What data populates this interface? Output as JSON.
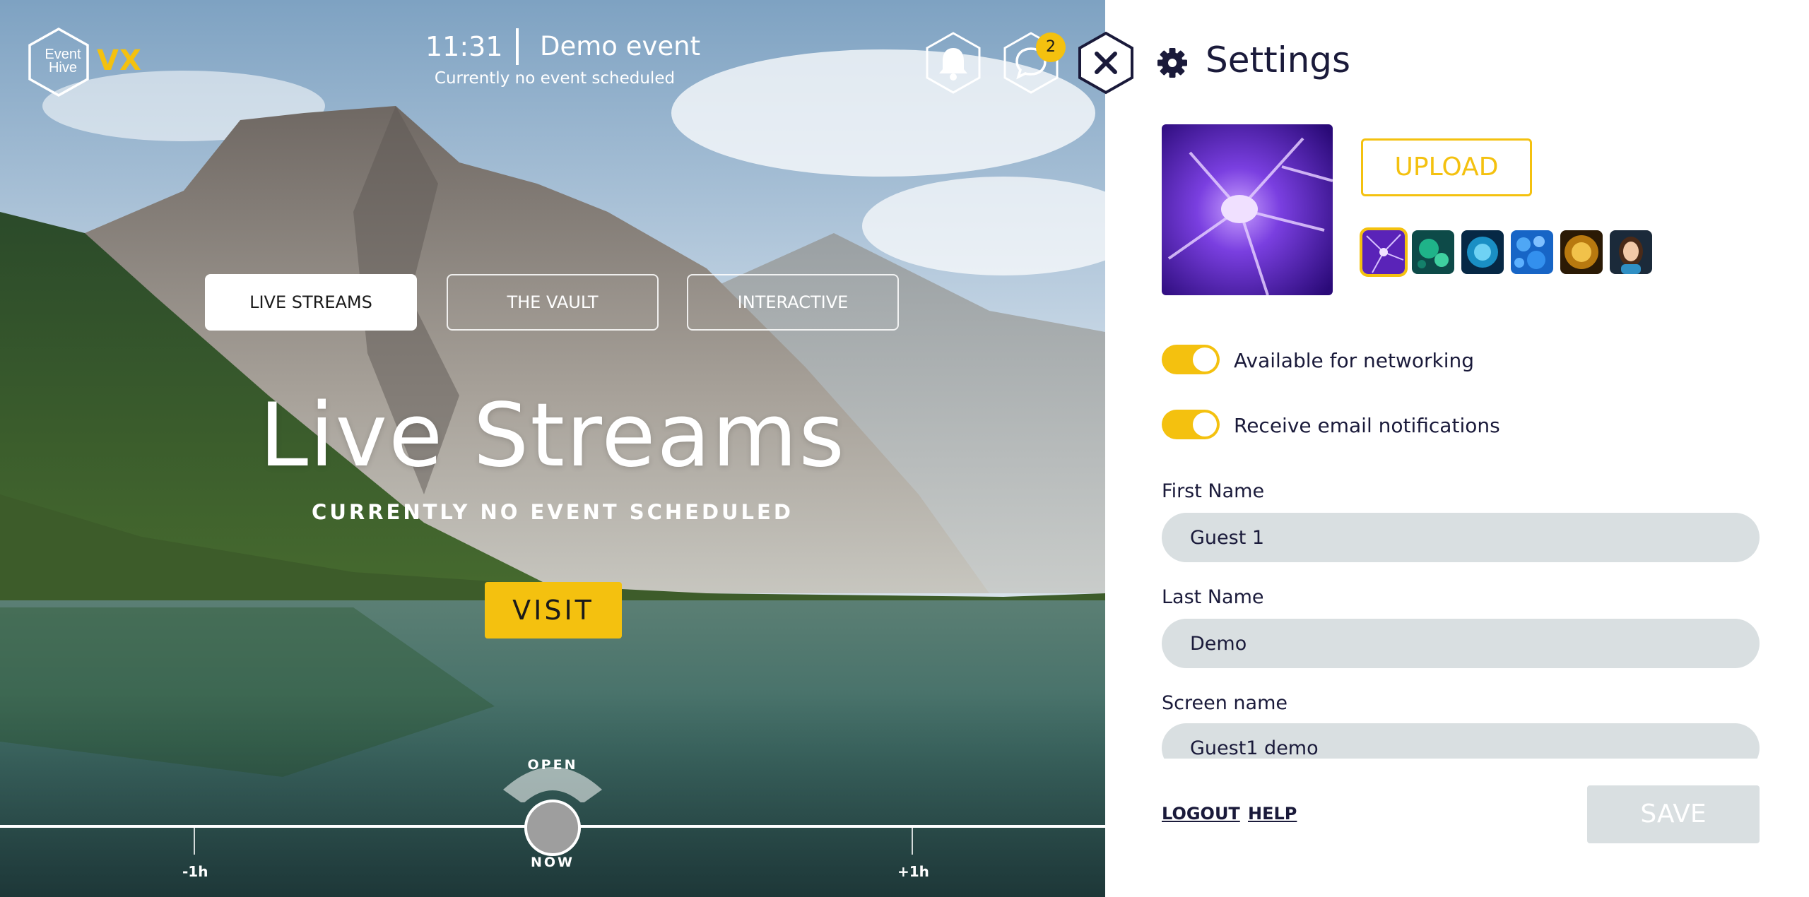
{
  "header": {
    "logo_text_line1": "Event",
    "logo_text_line2": "Hive",
    "logo_suffix": "VX",
    "time": "11:31",
    "event_title": "Demo event",
    "event_subtitle": "Currently no event scheduled",
    "notifications_icon": "bell-icon",
    "chat_icon": "chat-bubble-icon",
    "chat_badge_count": "2"
  },
  "tabs": [
    {
      "label": "LIVE STREAMS",
      "active": true
    },
    {
      "label": "THE VAULT",
      "active": false
    },
    {
      "label": "INTERACTIVE",
      "active": false
    }
  ],
  "hero": {
    "title": "Live Streams",
    "subtitle": "CURRENTLY NO EVENT SCHEDULED",
    "cta_label": "VISIT"
  },
  "timeline": {
    "left_tick": "-1h",
    "right_tick": "+1h",
    "open_label": "OPEN",
    "now_label": "NOW"
  },
  "settings": {
    "title": "Settings",
    "upload_label": "UPLOAD",
    "avatar_options": [
      "neuron-purple",
      "cells-green",
      "cell-blue",
      "cells-blue",
      "cell-gold",
      "person-avatar"
    ],
    "selected_avatar": 0,
    "toggles": [
      {
        "label": "Available for networking",
        "on": true
      },
      {
        "label": "Receive email notifications",
        "on": true
      }
    ],
    "fields": {
      "first_name_label": "First Name",
      "first_name_value": "Guest 1",
      "last_name_label": "Last Name",
      "last_name_value": "Demo",
      "screen_name_label": "Screen name",
      "screen_name_value": "Guest1 demo"
    },
    "logout_label": "LOGOUT",
    "help_label": "HELP",
    "save_label": "SAVE"
  },
  "colors": {
    "accent": "#f4c10f",
    "panel_bg": "#ffffff",
    "field_bg": "#d9dfe1",
    "text_dark": "#1a1a3a"
  }
}
